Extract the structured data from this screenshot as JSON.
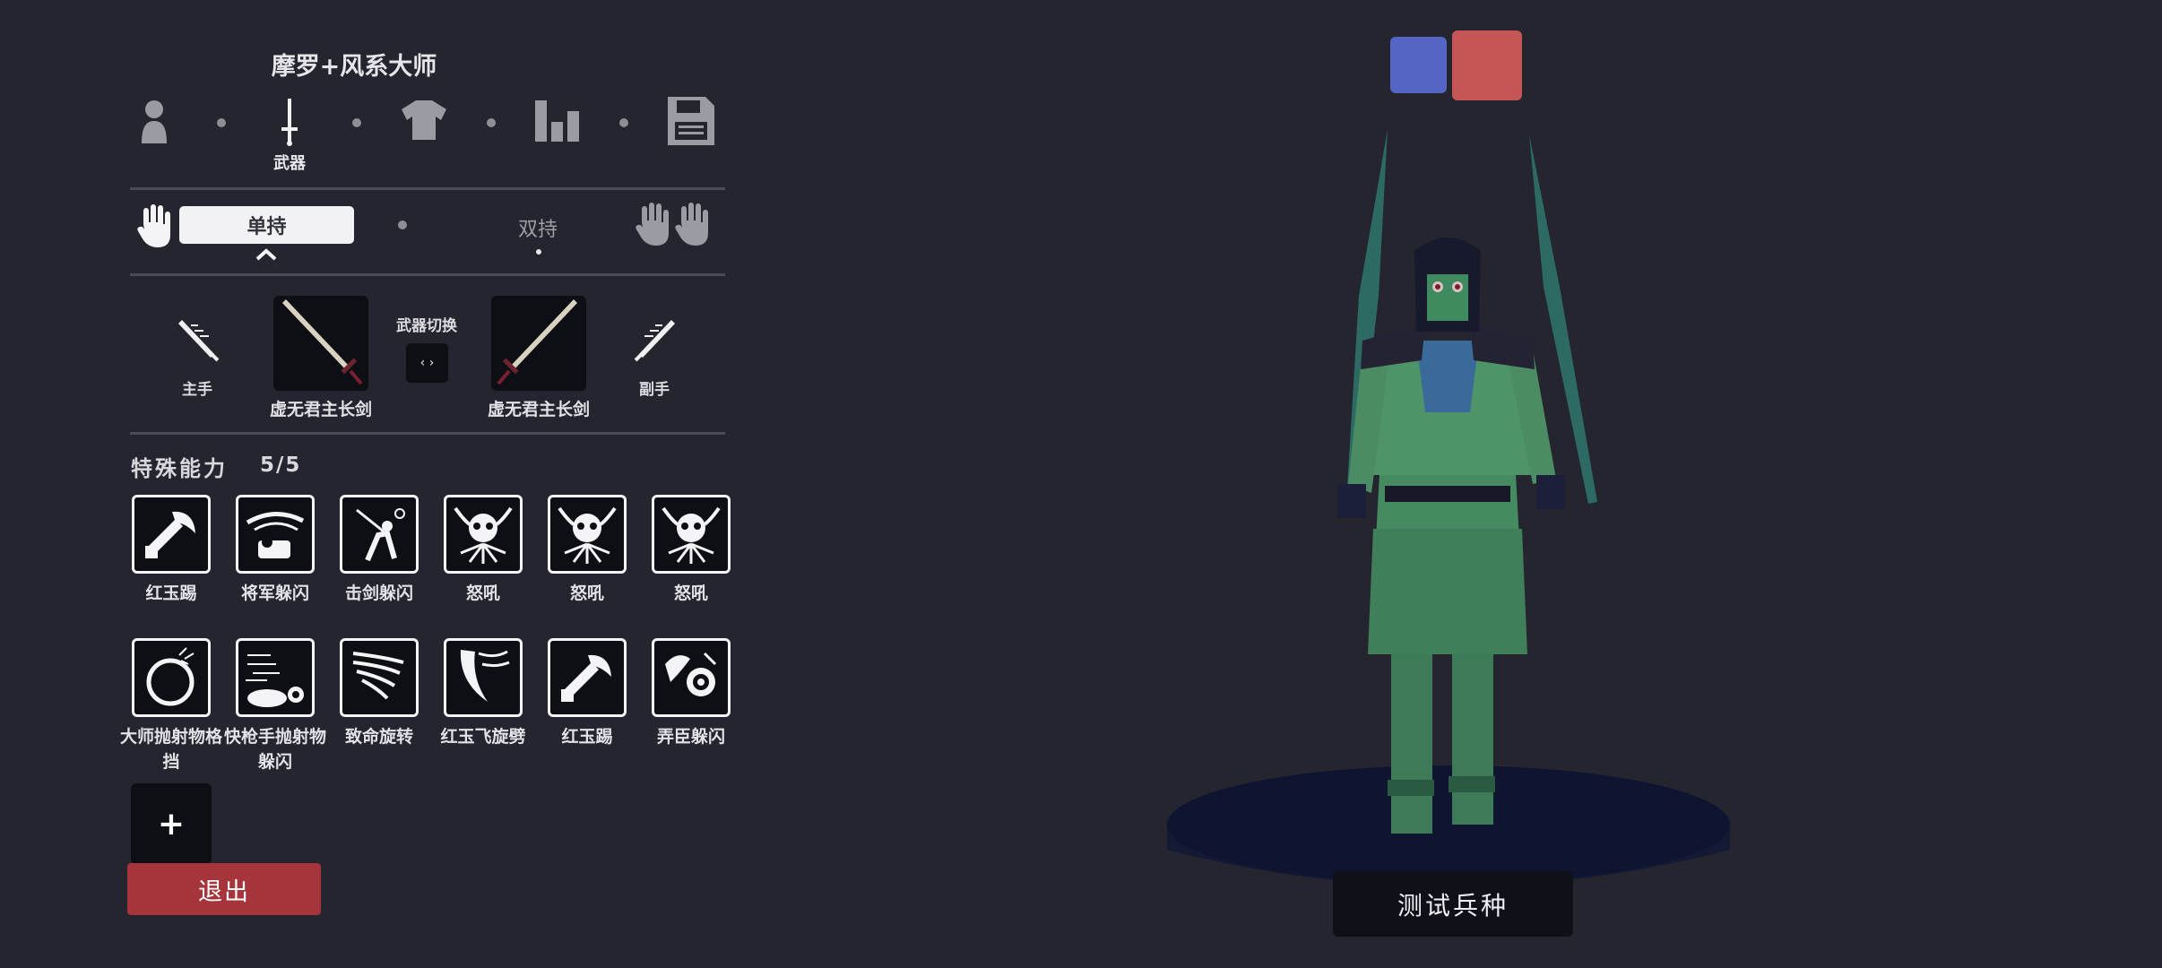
{
  "unit_title": "摩罗+风系大师",
  "steps": [
    {
      "icon": "unit-body-icon",
      "label": ""
    },
    {
      "icon": "sword-icon",
      "label": "武器"
    },
    {
      "icon": "shirt-icon",
      "label": ""
    },
    {
      "icon": "stats-bars-icon",
      "label": ""
    },
    {
      "icon": "save-disk-icon",
      "label": ""
    }
  ],
  "grip": {
    "single_label": "单持",
    "dual_label": "双持"
  },
  "weapons": {
    "main_hand_label": "主手",
    "off_hand_label": "副手",
    "switch_label": "武器切换",
    "switch_glyph": "‹ ›",
    "main_weapon_name": "虚无君主长剑",
    "off_weapon_name": "虚无君主长剑"
  },
  "abilities": {
    "title": "特殊能力",
    "count": "5/5",
    "items": [
      {
        "label": "红玉踢",
        "icon": "hammer-blade-icon"
      },
      {
        "label": "将军躲闪",
        "icon": "general-dodge-icon"
      },
      {
        "label": "击剑躲闪",
        "icon": "fencer-dodge-icon"
      },
      {
        "label": "怒吼",
        "icon": "roar-skull-icon"
      },
      {
        "label": "怒吼",
        "icon": "roar-skull-icon"
      },
      {
        "label": "怒吼",
        "icon": "roar-skull-icon"
      },
      {
        "label": "大师抛射物格挡",
        "icon": "projectile-block-icon"
      },
      {
        "label": "快枪手抛射物躲闪",
        "icon": "gunslinger-dodge-icon"
      },
      {
        "label": "致命旋转",
        "icon": "deadly-spin-icon"
      },
      {
        "label": "红玉飞旋劈",
        "icon": "spin-slash-icon"
      },
      {
        "label": "红玉踢",
        "icon": "hammer-blade-icon"
      },
      {
        "label": "弄臣躲闪",
        "icon": "jester-dodge-icon"
      }
    ],
    "add_label": "+"
  },
  "exit_label": "退出",
  "test_label": "测试兵种",
  "colors": {
    "background": "#24252f",
    "team_blue": "#5565c4",
    "team_red": "#c65656",
    "exit_red": "#a6343b"
  }
}
